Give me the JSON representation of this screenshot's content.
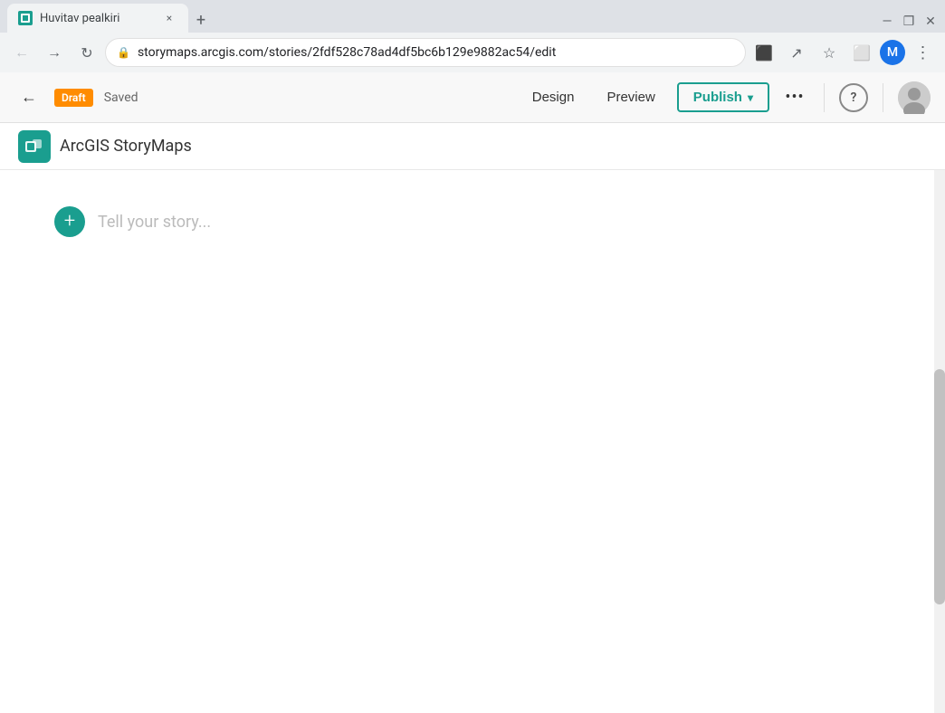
{
  "browser": {
    "tab": {
      "favicon_alt": "ArcGIS StoryMaps favicon",
      "title": "Huvitav pealkiri",
      "close_label": "×"
    },
    "new_tab_label": "+",
    "window_controls": {
      "minimize": "—",
      "restore": "❐",
      "close": "✕"
    },
    "address_bar": {
      "url": "storymaps.arcgis.com/stories/2fdf528c78ad4df5bc6b129e9882ac54/edit"
    },
    "nav": {
      "back_label": "←",
      "forward_label": "→",
      "reload_label": "↻"
    }
  },
  "app": {
    "toolbar": {
      "back_label": "←",
      "draft_badge": "Draft",
      "saved_label": "Saved",
      "design_label": "Design",
      "preview_label": "Preview",
      "publish_label": "Publish",
      "more_label": "•••",
      "help_label": "?"
    },
    "brand": {
      "name": "ArcGIS StoryMaps"
    },
    "story": {
      "placeholder": "Tell your story...",
      "add_block_label": "+"
    }
  }
}
